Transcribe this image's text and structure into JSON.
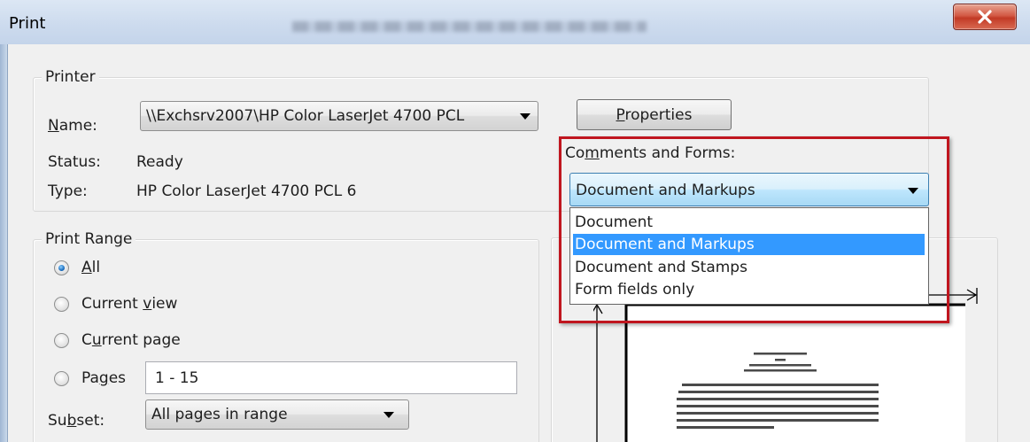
{
  "window": {
    "title": "Print",
    "close_label": "X"
  },
  "printer": {
    "group_label": "Printer",
    "name_label_pre": "",
    "name_label_u": "N",
    "name_label_post": "ame:",
    "name_value": "\\\\Exchsrv2007\\HP Color LaserJet 4700 PCL",
    "status_label": "Status:",
    "status_value": "Ready",
    "type_label": "Type:",
    "type_value": "HP Color LaserJet 4700 PCL 6",
    "properties_pre": "",
    "properties_u": "P",
    "properties_post": "roperties"
  },
  "comments_forms": {
    "label_pre": "Co",
    "label_u": "m",
    "label_post": "ments and Forms:",
    "selected": "Document and Markups",
    "options": [
      "Document",
      "Document and Markups",
      "Document and Stamps",
      "Form fields only"
    ],
    "highlight_color": "#3399ff",
    "callout_color": "#c0161f"
  },
  "print_range": {
    "group_label": "Print Range",
    "all_pre": "",
    "all_u": "A",
    "all_post": "ll",
    "current_view_pre": "Current ",
    "current_view_u": "v",
    "current_view_post": "iew",
    "current_page_pre": "C",
    "current_page_u": "u",
    "current_page_post": "rrent page",
    "pages_pre": "Pa",
    "pages_u": "g",
    "pages_post": "es",
    "pages_value": "1 - 15",
    "subset_pre": "Su",
    "subset_u": "b",
    "subset_post": "set:",
    "subset_value": "All pages in range",
    "selected_option": "All"
  }
}
